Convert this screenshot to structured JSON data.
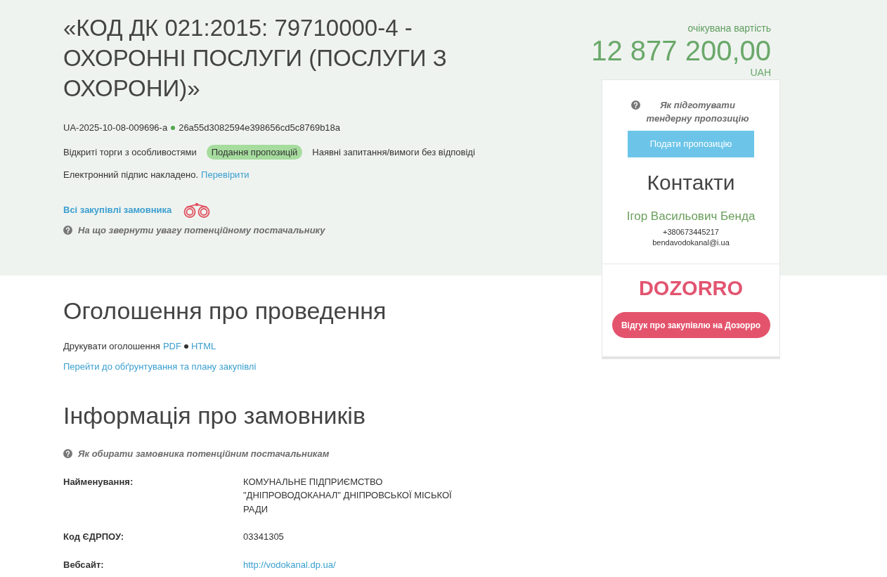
{
  "header": {
    "title": "«КОД ДК 021:2015: 79710000-4 - ОХОРОННІ ПОСЛУГИ (ПОСЛУГИ З ОХОРОНИ)»",
    "tender_id": "UA-2025-10-08-009696-a",
    "hash": "26a55d3082594e398656cd5c8769b18a",
    "procedure_type": "Відкриті торги з особливостями",
    "status_badge": "Подання пропозицій",
    "notice": "Наявні запитання/вимоги без відповіді",
    "signature": {
      "text": "Електронний підпис накладено.",
      "link": "Перевірити"
    },
    "all_purchases_link": "Всі закупівлі замовника",
    "help": "На що звернути увагу потенційному постачальнику"
  },
  "value": {
    "label": "очікувана вартість",
    "amount": "12 877 200,00",
    "currency": "UAH"
  },
  "sidebar": {
    "help": "Як підготувати тендерну пропозицію",
    "submit_button": "Подати пропозицію",
    "contacts_title": "Контакти",
    "contact_name": "Ігор Васильович Бенда",
    "phone": "+380673445217",
    "email": "bendavodokanal@i.ua",
    "logo": "DOZORRO",
    "review_button": "Відгук про закупівлю на Дозорро"
  },
  "announcement": {
    "title": "Оголошення про проведення",
    "print_label": "Друкувати оголошення",
    "print_links": [
      "PDF",
      "HTML"
    ],
    "plan_link": "Перейти до обґрунтування та плану закупівлі"
  },
  "customers": {
    "title": "Інформація про замовників",
    "help": "Як обирати замовника потенційним постачальникам",
    "fields": [
      {
        "label": "Найменування:",
        "value": "КОМУНАЛЬНЕ ПІДПРИЄМСТВО \"ДНІПРОВОДОКАНАЛ\" ДНІПРОВСЬКОЇ МІСЬКОЇ РАДИ",
        "kind": "text"
      },
      {
        "label": "Код ЄДРПОУ:",
        "value": "03341305",
        "kind": "text"
      },
      {
        "label": "Вебсайт:",
        "value": "http://vodokanal.dp.ua/",
        "kind": "link"
      }
    ]
  }
}
